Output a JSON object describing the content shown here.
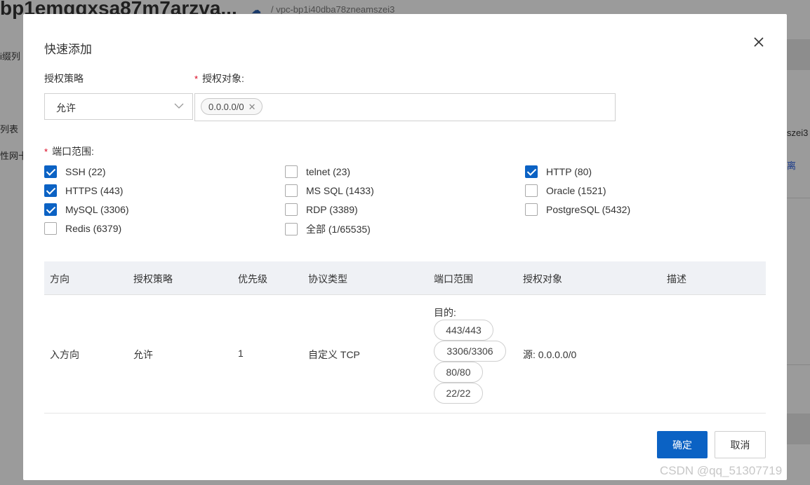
{
  "background": {
    "title": "bp1emqqxsa87m7arzva...",
    "vpc": "/ vpc-bp1i40dba78zneamszei3",
    "left_items": [
      "i缀列",
      "列表",
      "性网卡"
    ],
    "right_items": [
      "szei3",
      "离"
    ]
  },
  "modal": {
    "title": "快速添加",
    "close_icon": "close-icon",
    "policy_label": "授权策略",
    "policy_value": "允许",
    "target_label": "授权对象:",
    "target_tag": "0.0.0.0/0",
    "ports_label": "端口范围:",
    "ports": [
      {
        "label": "SSH (22)",
        "checked": true
      },
      {
        "label": "telnet (23)",
        "checked": false
      },
      {
        "label": "HTTP (80)",
        "checked": true
      },
      {
        "label": "HTTPS (443)",
        "checked": true
      },
      {
        "label": "MS SQL (1433)",
        "checked": false
      },
      {
        "label": "Oracle (1521)",
        "checked": false
      },
      {
        "label": "MySQL (3306)",
        "checked": true
      },
      {
        "label": "RDP (3389)",
        "checked": false
      },
      {
        "label": "PostgreSQL (5432)",
        "checked": false
      },
      {
        "label": "Redis (6379)",
        "checked": false
      },
      {
        "label": "全部 (1/65535)",
        "checked": false
      }
    ],
    "table": {
      "headers": [
        "方向",
        "授权策略",
        "优先级",
        "协议类型",
        "端口范围",
        "授权对象",
        "描述"
      ],
      "row": {
        "direction": "入方向",
        "policy": "允许",
        "priority": "1",
        "protocol": "自定义 TCP",
        "ports_prefix": "目的:",
        "ports": [
          "443/443",
          "3306/3306",
          "80/80",
          "22/22"
        ],
        "target": "源: 0.0.0.0/0",
        "description": ""
      }
    },
    "ok_label": "确定",
    "cancel_label": "取消"
  },
  "watermark": "CSDN @qq_51307719",
  "colors": {
    "primary": "#0b62c4",
    "required": "#d9001b",
    "table_header": "#eff1f5"
  }
}
